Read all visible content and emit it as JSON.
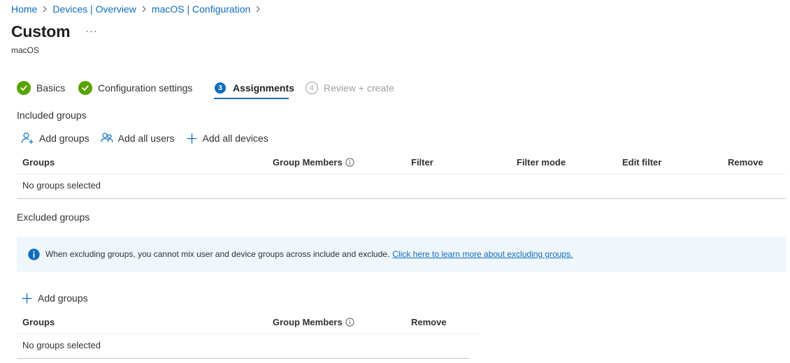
{
  "breadcrumb": [
    {
      "label": "Home"
    },
    {
      "label": "Devices | Overview"
    },
    {
      "label": "macOS | Configuration"
    }
  ],
  "page": {
    "title": "Custom",
    "subtitle": "macOS",
    "more_label": "···"
  },
  "wizard": {
    "steps": [
      {
        "label": "Basics",
        "state": "completed"
      },
      {
        "label": "Configuration settings",
        "state": "completed"
      },
      {
        "label": "Assignments",
        "number": "3",
        "state": "current"
      },
      {
        "label": "Review + create",
        "number": "4",
        "state": "disabled"
      }
    ]
  },
  "included": {
    "title": "Included groups",
    "commands": {
      "add_groups": "Add groups",
      "add_all_users": "Add all users",
      "add_all_devices": "Add all devices"
    },
    "columns": {
      "groups": "Groups",
      "group_members": "Group Members",
      "filter": "Filter",
      "filter_mode": "Filter mode",
      "edit_filter": "Edit filter",
      "remove": "Remove"
    },
    "empty_text": "No groups selected"
  },
  "excluded": {
    "title": "Excluded groups",
    "info": {
      "message": "When excluding groups, you cannot mix user and device groups across include and exclude.",
      "link": "Click here to learn more about excluding groups."
    },
    "commands": {
      "add_groups": "Add groups"
    },
    "columns": {
      "groups": "Groups",
      "group_members": "Group Members",
      "remove": "Remove"
    },
    "empty_text": "No groups selected"
  },
  "colors": {
    "accent": "#0f6cbd",
    "success": "#57a300",
    "info_background": "#eff6fc",
    "disabled_text": "#a19f9d"
  },
  "icons": {
    "completed_step": "checkmark-circle-icon",
    "info": "info-icon",
    "add_groups": "person-add-icon",
    "add_all_users": "people-icon",
    "add": "plus-icon",
    "separator": "chevron-right-icon"
  }
}
